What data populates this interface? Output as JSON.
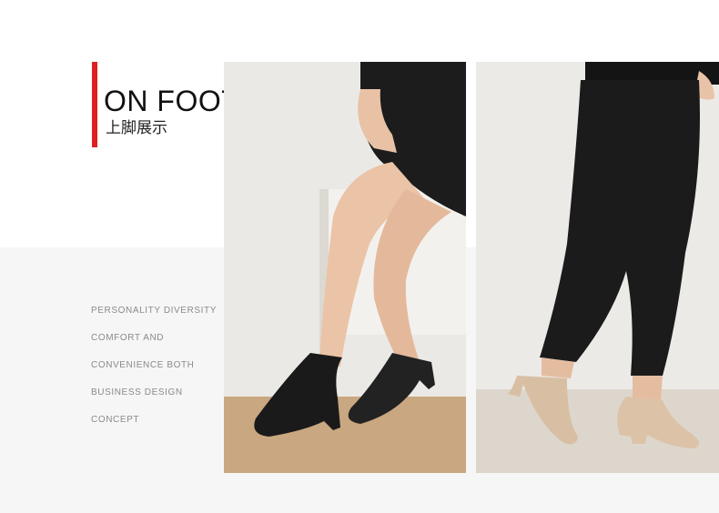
{
  "header": {
    "title": "ON FOOT",
    "subtitle": "上脚展示"
  },
  "features": [
    "PERSONALITY DIVERSITY",
    "COMFORT AND",
    "CONVENIENCE BOTH",
    "BUSINESS DESIGN",
    "CONCEPT"
  ],
  "colors": {
    "accent": "#e02020",
    "background_lower": "#f6f6f6",
    "text_muted": "#8a8a8a"
  },
  "photos": [
    {
      "name": "on-foot-photo-black-shoes",
      "shoe_color": "#1a1a1a"
    },
    {
      "name": "on-foot-photo-beige-shoes",
      "shoe_color": "#d8bfa4"
    }
  ]
}
